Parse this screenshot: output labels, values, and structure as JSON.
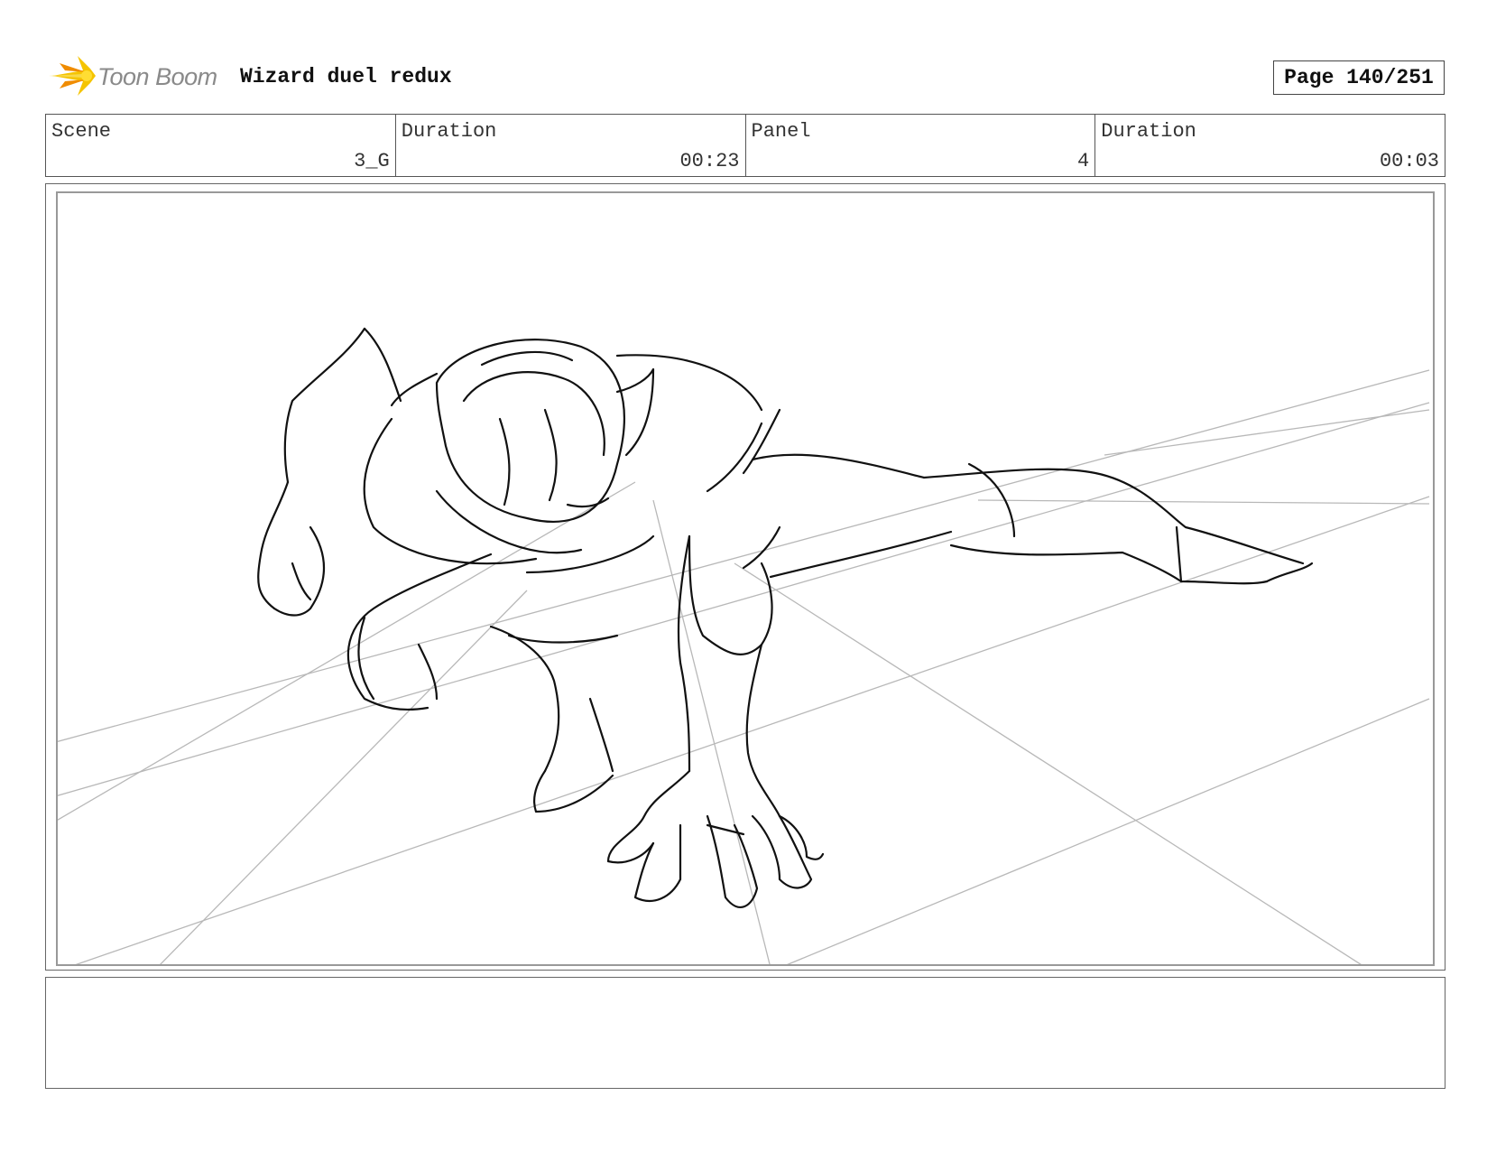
{
  "header": {
    "brand": "Toon Boom",
    "project_title": "Wizard duel redux",
    "page_label": "Page 140/251"
  },
  "info": {
    "scene_label": "Scene",
    "scene_value": "3_G",
    "scene_duration_label": "Duration",
    "scene_duration_value": "00:23",
    "panel_label": "Panel",
    "panel_value": "4",
    "panel_duration_label": "Duration",
    "panel_duration_value": "00:03"
  },
  "notes": {
    "text": ""
  },
  "colors": {
    "logo_yellow": "#f5c400",
    "logo_orange": "#f08c00",
    "logo_text": "#8a8a8a",
    "frame": "#555555"
  }
}
